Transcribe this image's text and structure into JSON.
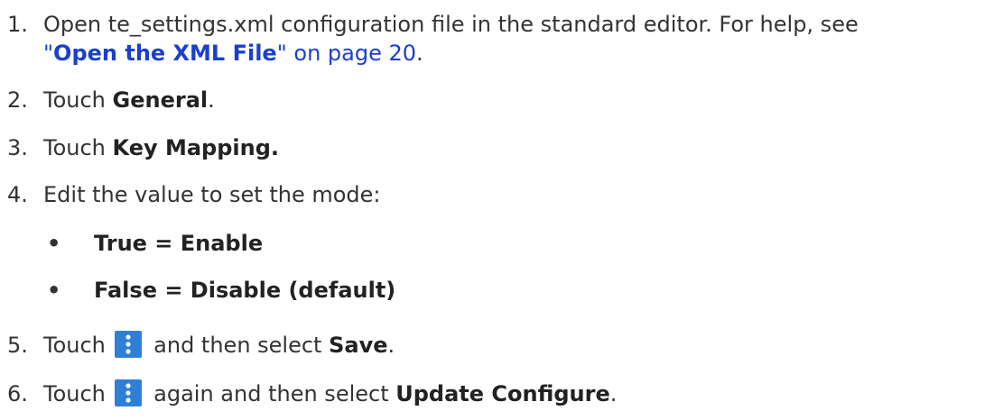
{
  "steps": {
    "s1": {
      "num": "1.",
      "text_a": "Open te_settings.xml configuration file in the standard editor. For help, see",
      "quote_open": "\"",
      "link_bold": "Open the XML File",
      "quote_close": "\"",
      "link_tail": " on page 20",
      "end": "."
    },
    "s2": {
      "num": "2.",
      "pre": "Touch ",
      "bold": "General",
      "post": "."
    },
    "s3": {
      "num": "3.",
      "pre": "Touch ",
      "bold": "Key Mapping.",
      "post": ""
    },
    "s4": {
      "num": "4.",
      "text": "Edit the value to set the mode:",
      "bullets": [
        "True = Enable",
        "False = Disable (default)"
      ],
      "bullet_char": "•"
    },
    "s5": {
      "num": "5.",
      "pre": "Touch ",
      "mid": " and then select ",
      "bold": "Save",
      "post": "."
    },
    "s6": {
      "num": "6.",
      "pre": "Touch ",
      "mid": " again and then select ",
      "bold": "Update Configure",
      "post": "."
    }
  },
  "colors": {
    "link": "#1a40cc",
    "menu_icon_bg": "#2f7fd6",
    "text": "#333333"
  },
  "icons": {
    "menu": "kebab-menu-icon"
  }
}
